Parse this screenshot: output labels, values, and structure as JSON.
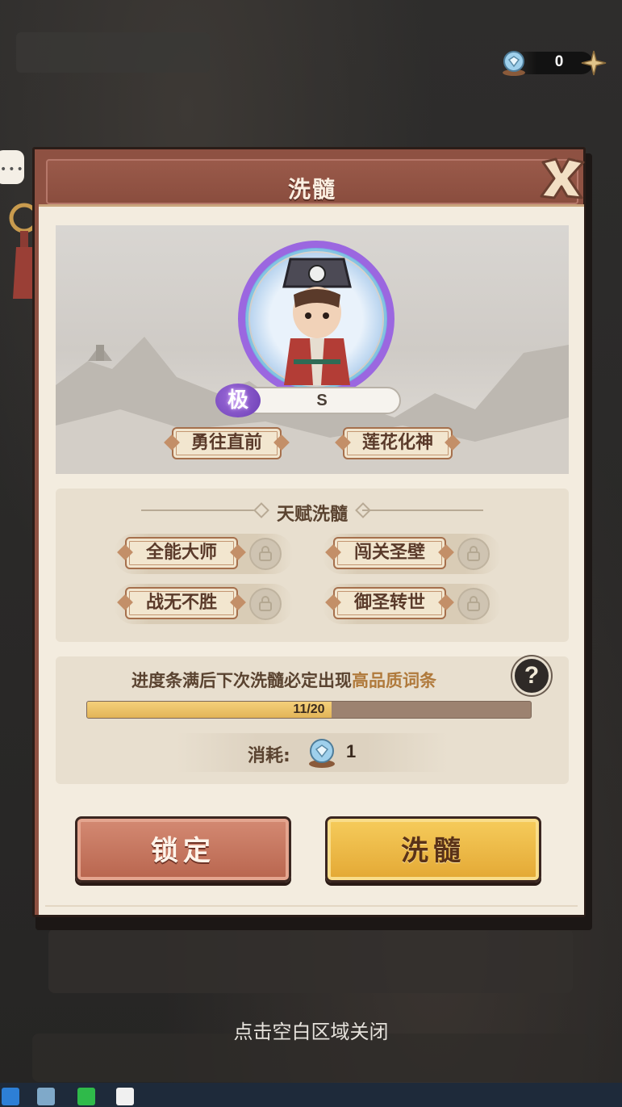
{
  "currency": {
    "value": "0",
    "icon": "crystal-gem-icon"
  },
  "panel": {
    "title": "洗髓"
  },
  "hero": {
    "grade_badge": "极",
    "grade_value": "S",
    "traits": [
      "勇往直前",
      "莲花化神"
    ]
  },
  "talent": {
    "header": "天赋洗髓",
    "items": [
      "全能大师",
      "闯关圣壁",
      "战无不胜",
      "御圣转世"
    ]
  },
  "progress": {
    "hint_prefix": "进度条满后下次洗髓必定出现",
    "hint_highlight": "高品质词条",
    "current": 11,
    "total": 20,
    "text": "11/20",
    "help_label": "?",
    "cost_label": "消耗:",
    "cost_value": "1"
  },
  "buttons": {
    "lock": "锁定",
    "wash": "洗髓"
  },
  "footer": {
    "close_hint": "点击空白区域关闭"
  },
  "colors": {
    "accent_gold": "#e3a834",
    "panel_red": "#8e5142",
    "highlight_text": "#b07a3c"
  }
}
